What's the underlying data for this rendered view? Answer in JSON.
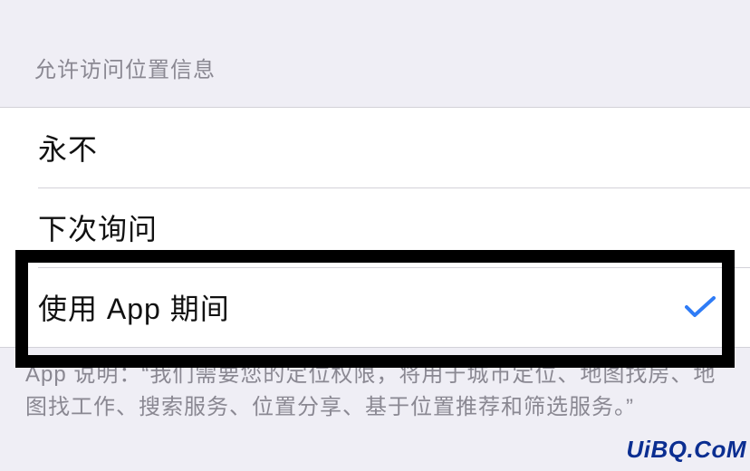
{
  "section_header": "允许访问位置信息",
  "options": {
    "never": {
      "label": "永不",
      "selected": false
    },
    "ask_next": {
      "label": "下次询问",
      "selected": false
    },
    "while_using": {
      "label": "使用 App 期间",
      "selected": true
    }
  },
  "footer_note": "App 说明：“我们需要您的定位权限，将用于城市定位、地图找房、地图找工作、搜索服务、位置分享、基于位置推荐和筛选服务。”",
  "watermark": "UiBQ.CoM",
  "checkmark_color": "#2f7cf6"
}
